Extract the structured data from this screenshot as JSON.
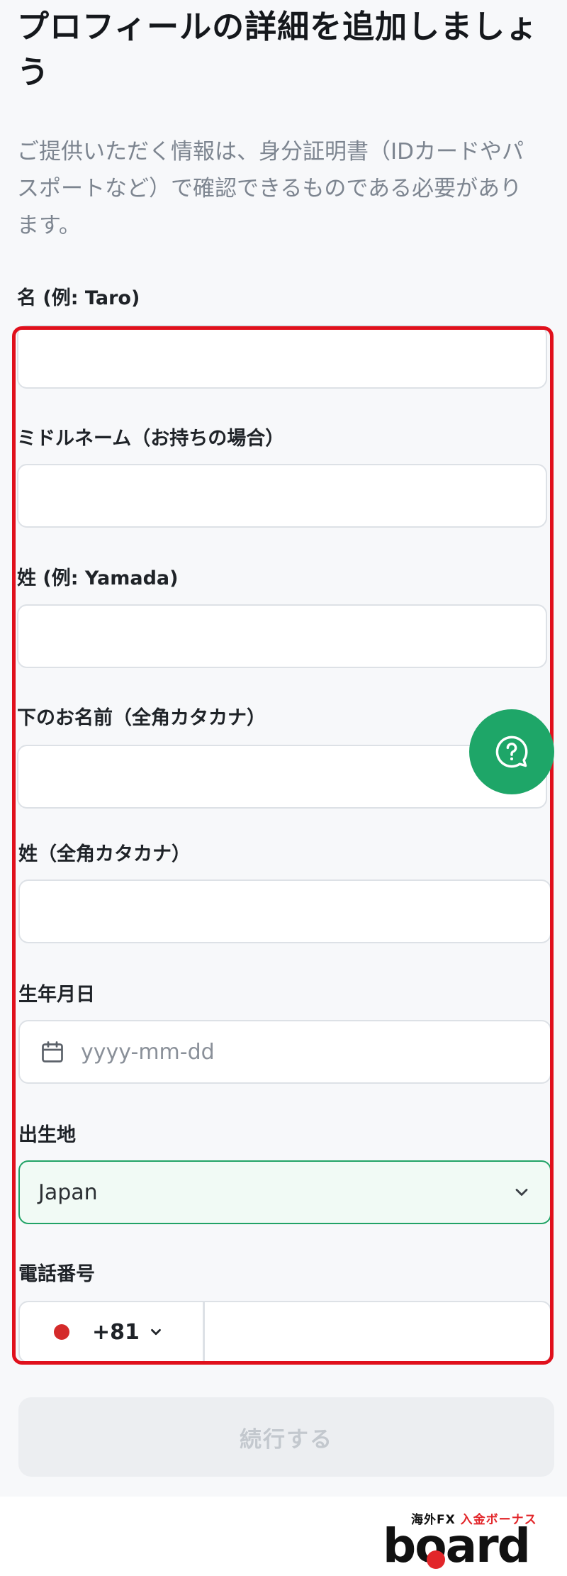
{
  "header": {
    "title": "プロフィールの詳細を追加しましょう",
    "intro": "ご提供いただく情報は、身分証明書（IDカードやパスポートなど）で確認できるものである必要があります。"
  },
  "form": {
    "first_name_label": "名 (例: Taro)",
    "first_name_value": "",
    "middle_name_label": "ミドルネーム（お持ちの場合）",
    "middle_name_value": "",
    "last_name_label": "姓 (例: Yamada)",
    "last_name_value": "",
    "first_name_kana_label": "下のお名前（全角カタカナ）",
    "first_name_kana_value": "",
    "last_name_kana_label": "姓（全角カタカナ）",
    "last_name_kana_value": "",
    "birthdate_label": "生年月日",
    "birthdate_placeholder": "yyyy-mm-dd",
    "birthdate_value": "",
    "birthplace_label": "出生地",
    "birthplace_value": "Japan",
    "phone_label": "電話番号",
    "phone_country_code": "+81",
    "phone_value": ""
  },
  "actions": {
    "continue_label": "続行する",
    "help_icon": "question-circle-icon"
  },
  "watermark": {
    "banner_part1": "海外FX",
    "banner_part2": "入金ボーナス",
    "wordmark": "board"
  },
  "colors": {
    "accent_green": "#1ea668",
    "highlight_red": "#e0101c",
    "flag_red": "#d42a2a",
    "disabled_button": "#eceef1"
  }
}
